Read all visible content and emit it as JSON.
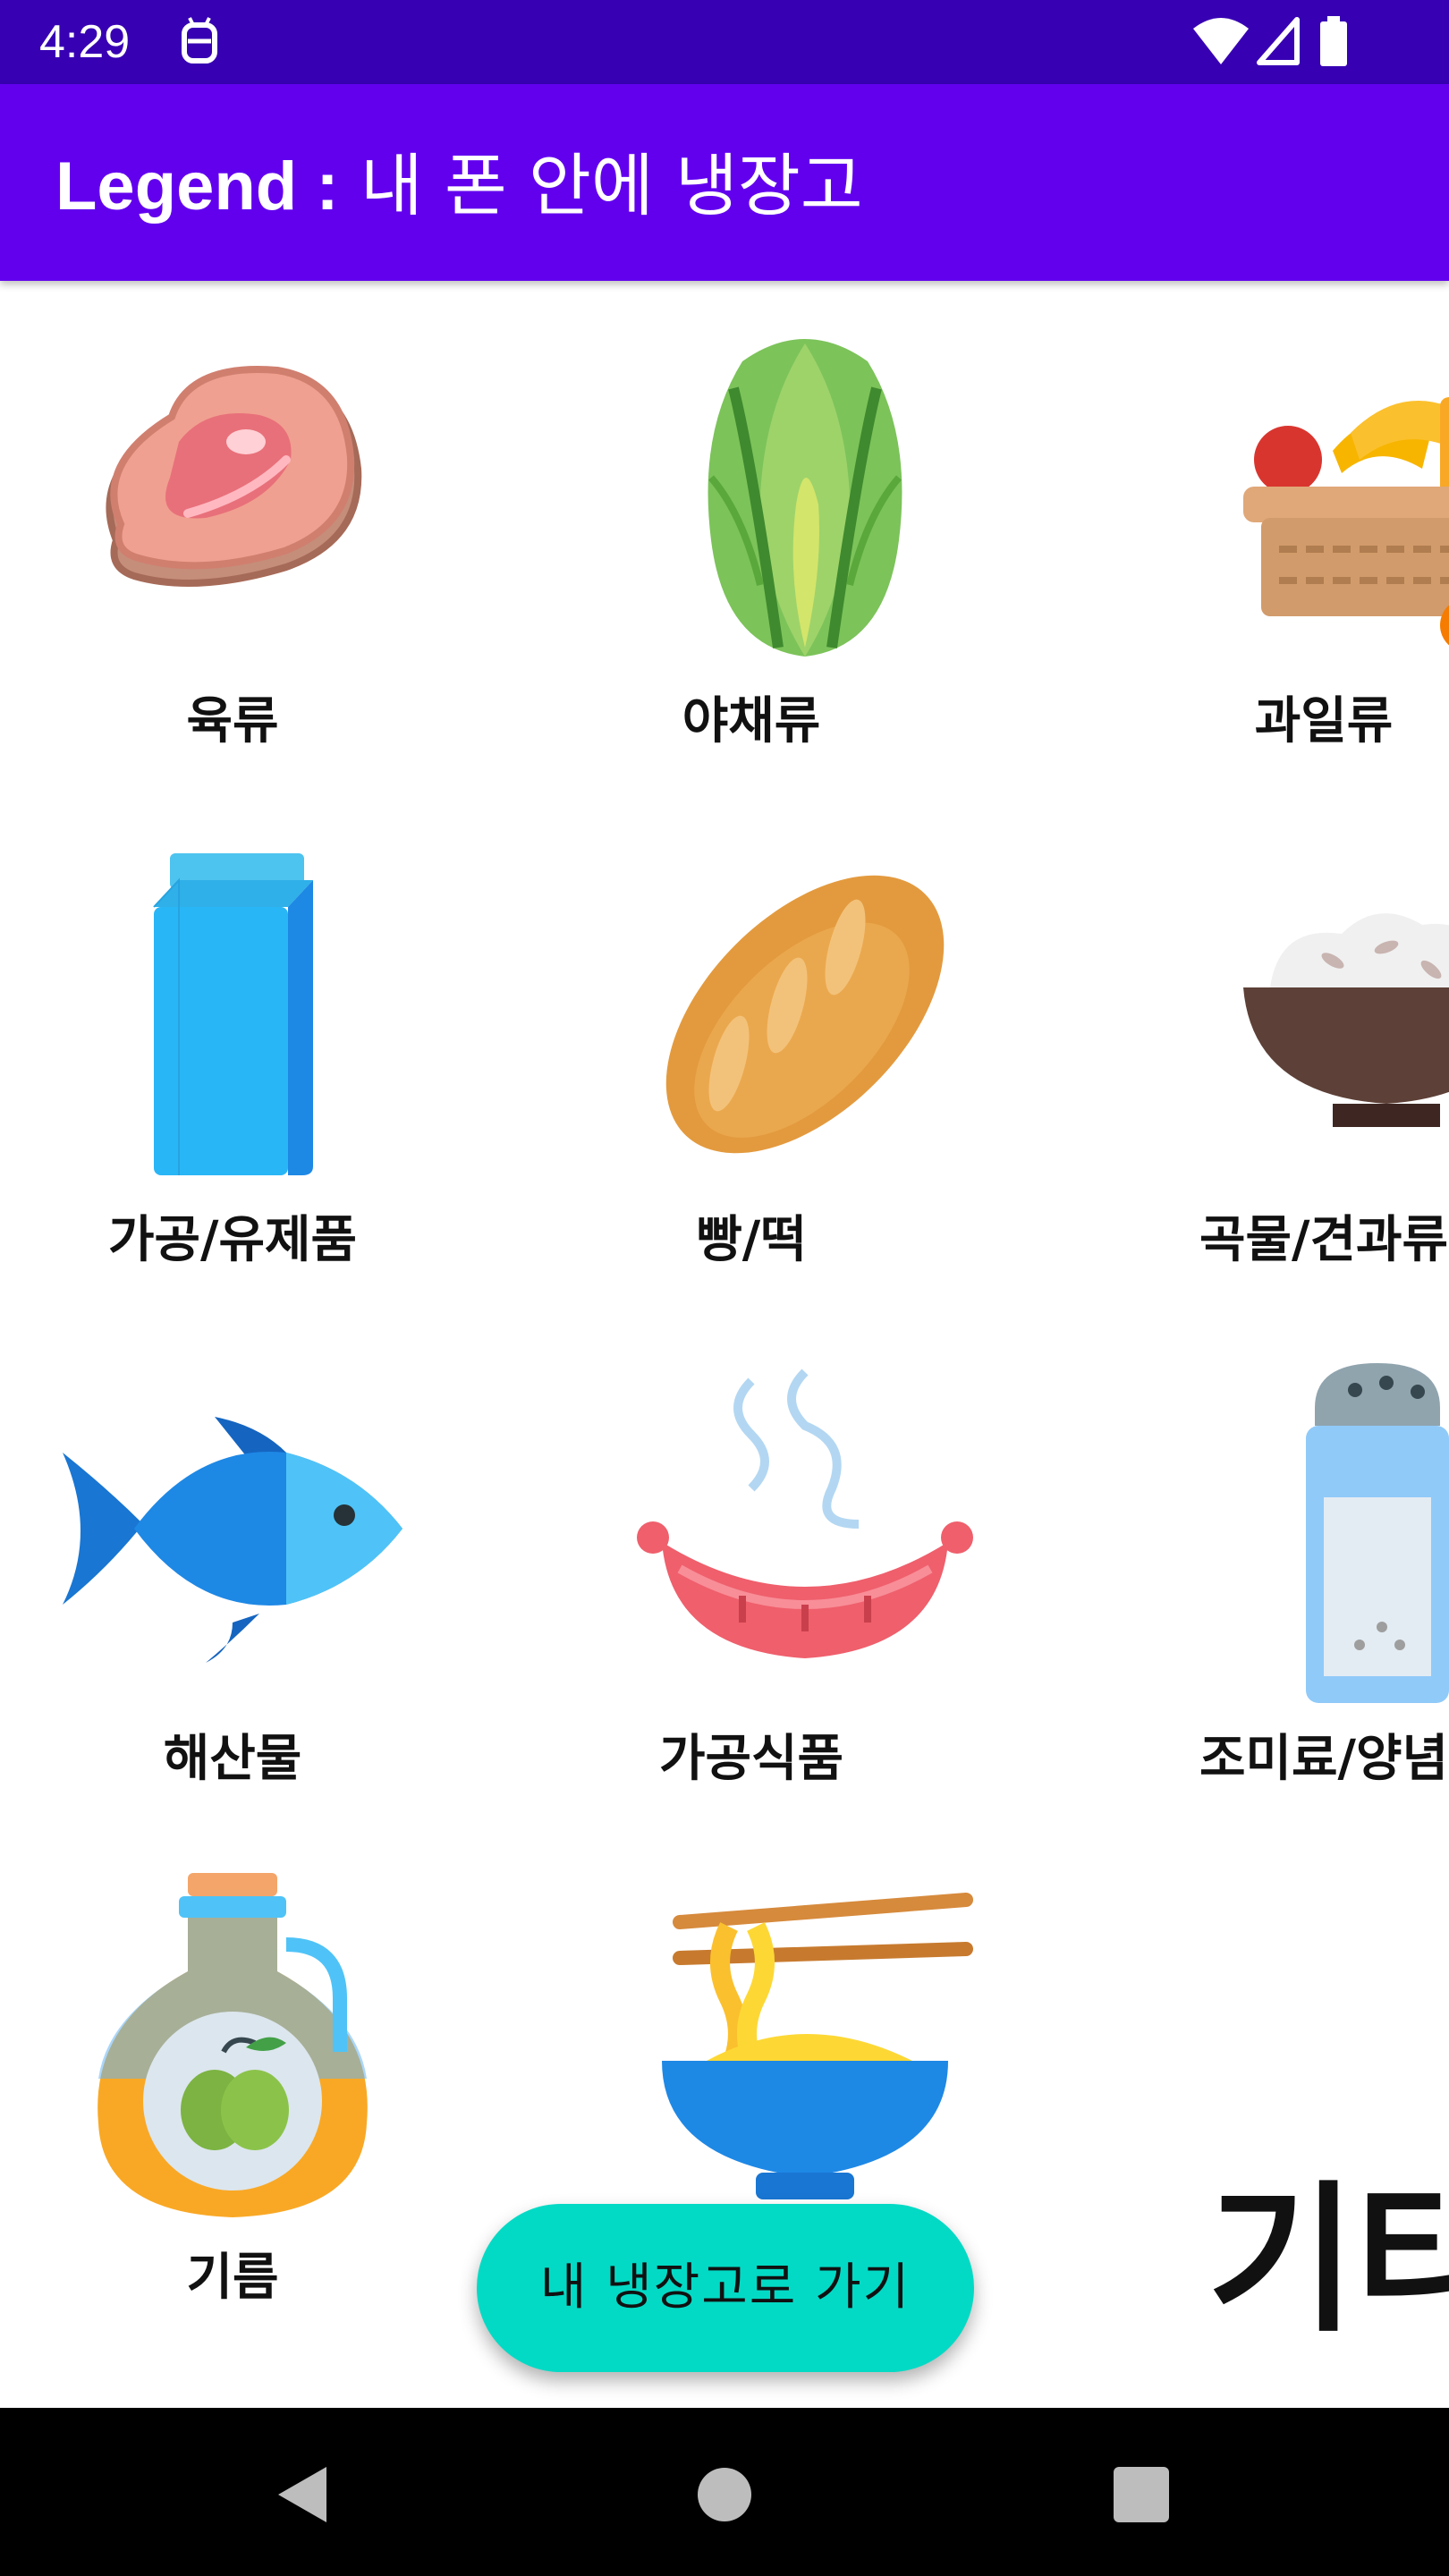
{
  "status_bar": {
    "time": "4:29",
    "icons": [
      "android-debug-icon",
      "wifi-icon",
      "cell-signal-icon",
      "battery-icon"
    ]
  },
  "app_bar": {
    "title_bold": "Legend :",
    "title_rest": " 내 폰 안에 냉장고",
    "color": "#6200ee"
  },
  "categories": [
    {
      "label": "육류",
      "icon": "meat-icon"
    },
    {
      "label": "야채류",
      "icon": "lettuce-icon"
    },
    {
      "label": "과일류",
      "icon": "fruit-basket-icon"
    },
    {
      "label": "가공/유제품",
      "icon": "milk-carton-icon"
    },
    {
      "label": "빵/떡",
      "icon": "bread-icon"
    },
    {
      "label": "곡물/견과류",
      "icon": "rice-bowl-icon"
    },
    {
      "label": "해산물",
      "icon": "fish-icon"
    },
    {
      "label": "가공식품",
      "icon": "sausage-icon"
    },
    {
      "label": "조미료/양념",
      "icon": "salt-shaker-icon"
    },
    {
      "label": "기름",
      "icon": "oil-bottle-icon"
    },
    {
      "label": "",
      "icon": "noodle-bowl-icon"
    },
    {
      "label": "기타",
      "icon": ""
    }
  ],
  "fab": {
    "label": "내 냉장고로 가기",
    "color": "#03dac5"
  },
  "nav_bar": {
    "buttons": [
      "back-icon",
      "home-icon",
      "recents-icon"
    ]
  }
}
